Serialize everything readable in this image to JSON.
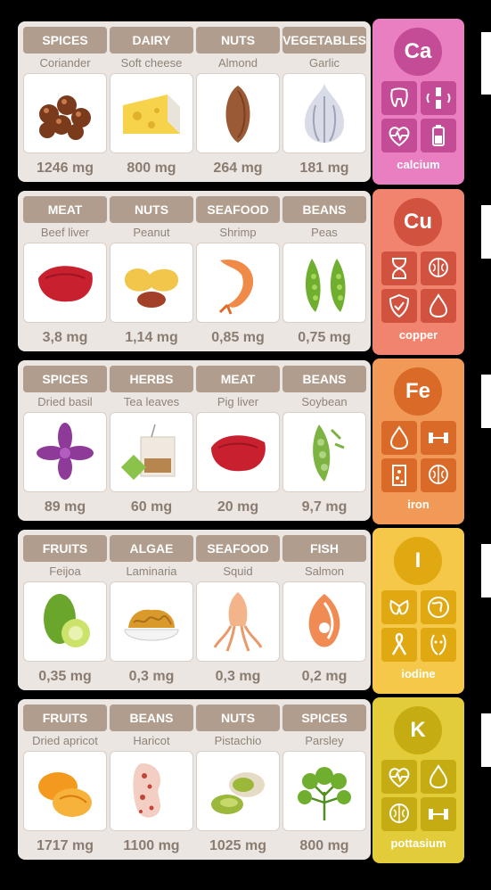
{
  "rows": [
    {
      "element": {
        "symbol": "Ca",
        "name": "calcium",
        "color": "#e97fc1",
        "dark": "#c44c97",
        "icons": [
          "tooth-icon",
          "joint-icon",
          "heart-pulse-icon",
          "battery-icon"
        ]
      },
      "items": [
        {
          "category": "SPICES",
          "food": "Coriander",
          "amount": "1246 mg",
          "icon": "coriander-seeds-icon"
        },
        {
          "category": "DAIRY",
          "food": "Soft cheese",
          "amount": "800 mg",
          "icon": "cheese-icon"
        },
        {
          "category": "NUTS",
          "food": "Almond",
          "amount": "264 mg",
          "icon": "almond-icon"
        },
        {
          "category": "VEGETABLES",
          "food": "Garlic",
          "amount": "181 mg",
          "icon": "garlic-icon"
        }
      ]
    },
    {
      "element": {
        "symbol": "Cu",
        "name": "copper",
        "color": "#f0846f",
        "dark": "#d1523e",
        "icons": [
          "hourglass-icon",
          "brain-icon",
          "shield-icon",
          "blood-drop-icon"
        ]
      },
      "items": [
        {
          "category": "MEAT",
          "food": "Beef liver",
          "amount": "3,8 mg",
          "icon": "beef-liver-icon"
        },
        {
          "category": "NUTS",
          "food": "Peanut",
          "amount": "1,14 mg",
          "icon": "peanut-icon"
        },
        {
          "category": "SEAFOOD",
          "food": "Shrimp",
          "amount": "0,85 mg",
          "icon": "shrimp-icon"
        },
        {
          "category": "BEANS",
          "food": "Peas",
          "amount": "0,75 mg",
          "icon": "peas-icon"
        }
      ]
    },
    {
      "element": {
        "symbol": "Fe",
        "name": "iron",
        "color": "#f19a57",
        "dark": "#d96a28",
        "icons": [
          "blood-drop-icon",
          "dumbbell-icon",
          "cell-icon",
          "brain-icon"
        ]
      },
      "items": [
        {
          "category": "SPICES",
          "food": "Dried basil",
          "amount": "89 mg",
          "icon": "basil-icon"
        },
        {
          "category": "HERBS",
          "food": "Tea leaves",
          "amount": "60 mg",
          "icon": "tea-bag-icon"
        },
        {
          "category": "MEAT",
          "food": "Pig liver",
          "amount": "20 mg",
          "icon": "pig-liver-icon"
        },
        {
          "category": "BEANS",
          "food": "Soybean",
          "amount": "9,7 mg",
          "icon": "soybean-icon"
        }
      ]
    },
    {
      "element": {
        "symbol": "I",
        "name": "iodine",
        "color": "#f5c84a",
        "dark": "#e0a912",
        "icons": [
          "thyroid-icon",
          "globe-icon",
          "ribbon-icon",
          "face-icon"
        ]
      },
      "items": [
        {
          "category": "FRUITS",
          "food": "Feijoa",
          "amount": "0,35 mg",
          "icon": "feijoa-icon"
        },
        {
          "category": "ALGAE",
          "food": "Laminaria",
          "amount": "0,3 mg",
          "icon": "seaweed-icon"
        },
        {
          "category": "SEAFOOD",
          "food": "Squid",
          "amount": "0,3 mg",
          "icon": "squid-icon"
        },
        {
          "category": "FISH",
          "food": "Salmon",
          "amount": "0,2 mg",
          "icon": "salmon-icon"
        }
      ]
    },
    {
      "element": {
        "symbol": "K",
        "name": "pottasium",
        "color": "#e2cc3a",
        "dark": "#c4ac12",
        "icons": [
          "heart-pulse-icon",
          "blood-drop-icon",
          "brain-icon",
          "dumbbell-icon"
        ]
      },
      "items": [
        {
          "category": "FRUITS",
          "food": "Dried apricot",
          "amount": "1717 mg",
          "icon": "apricot-icon"
        },
        {
          "category": "BEANS",
          "food": "Haricot",
          "amount": "1100 mg",
          "icon": "bean-icon"
        },
        {
          "category": "NUTS",
          "food": "Pistachio",
          "amount": "1025 mg",
          "icon": "pistachio-icon"
        },
        {
          "category": "SPICES",
          "food": "Parsley",
          "amount": "800 mg",
          "icon": "parsley-icon"
        }
      ]
    }
  ]
}
